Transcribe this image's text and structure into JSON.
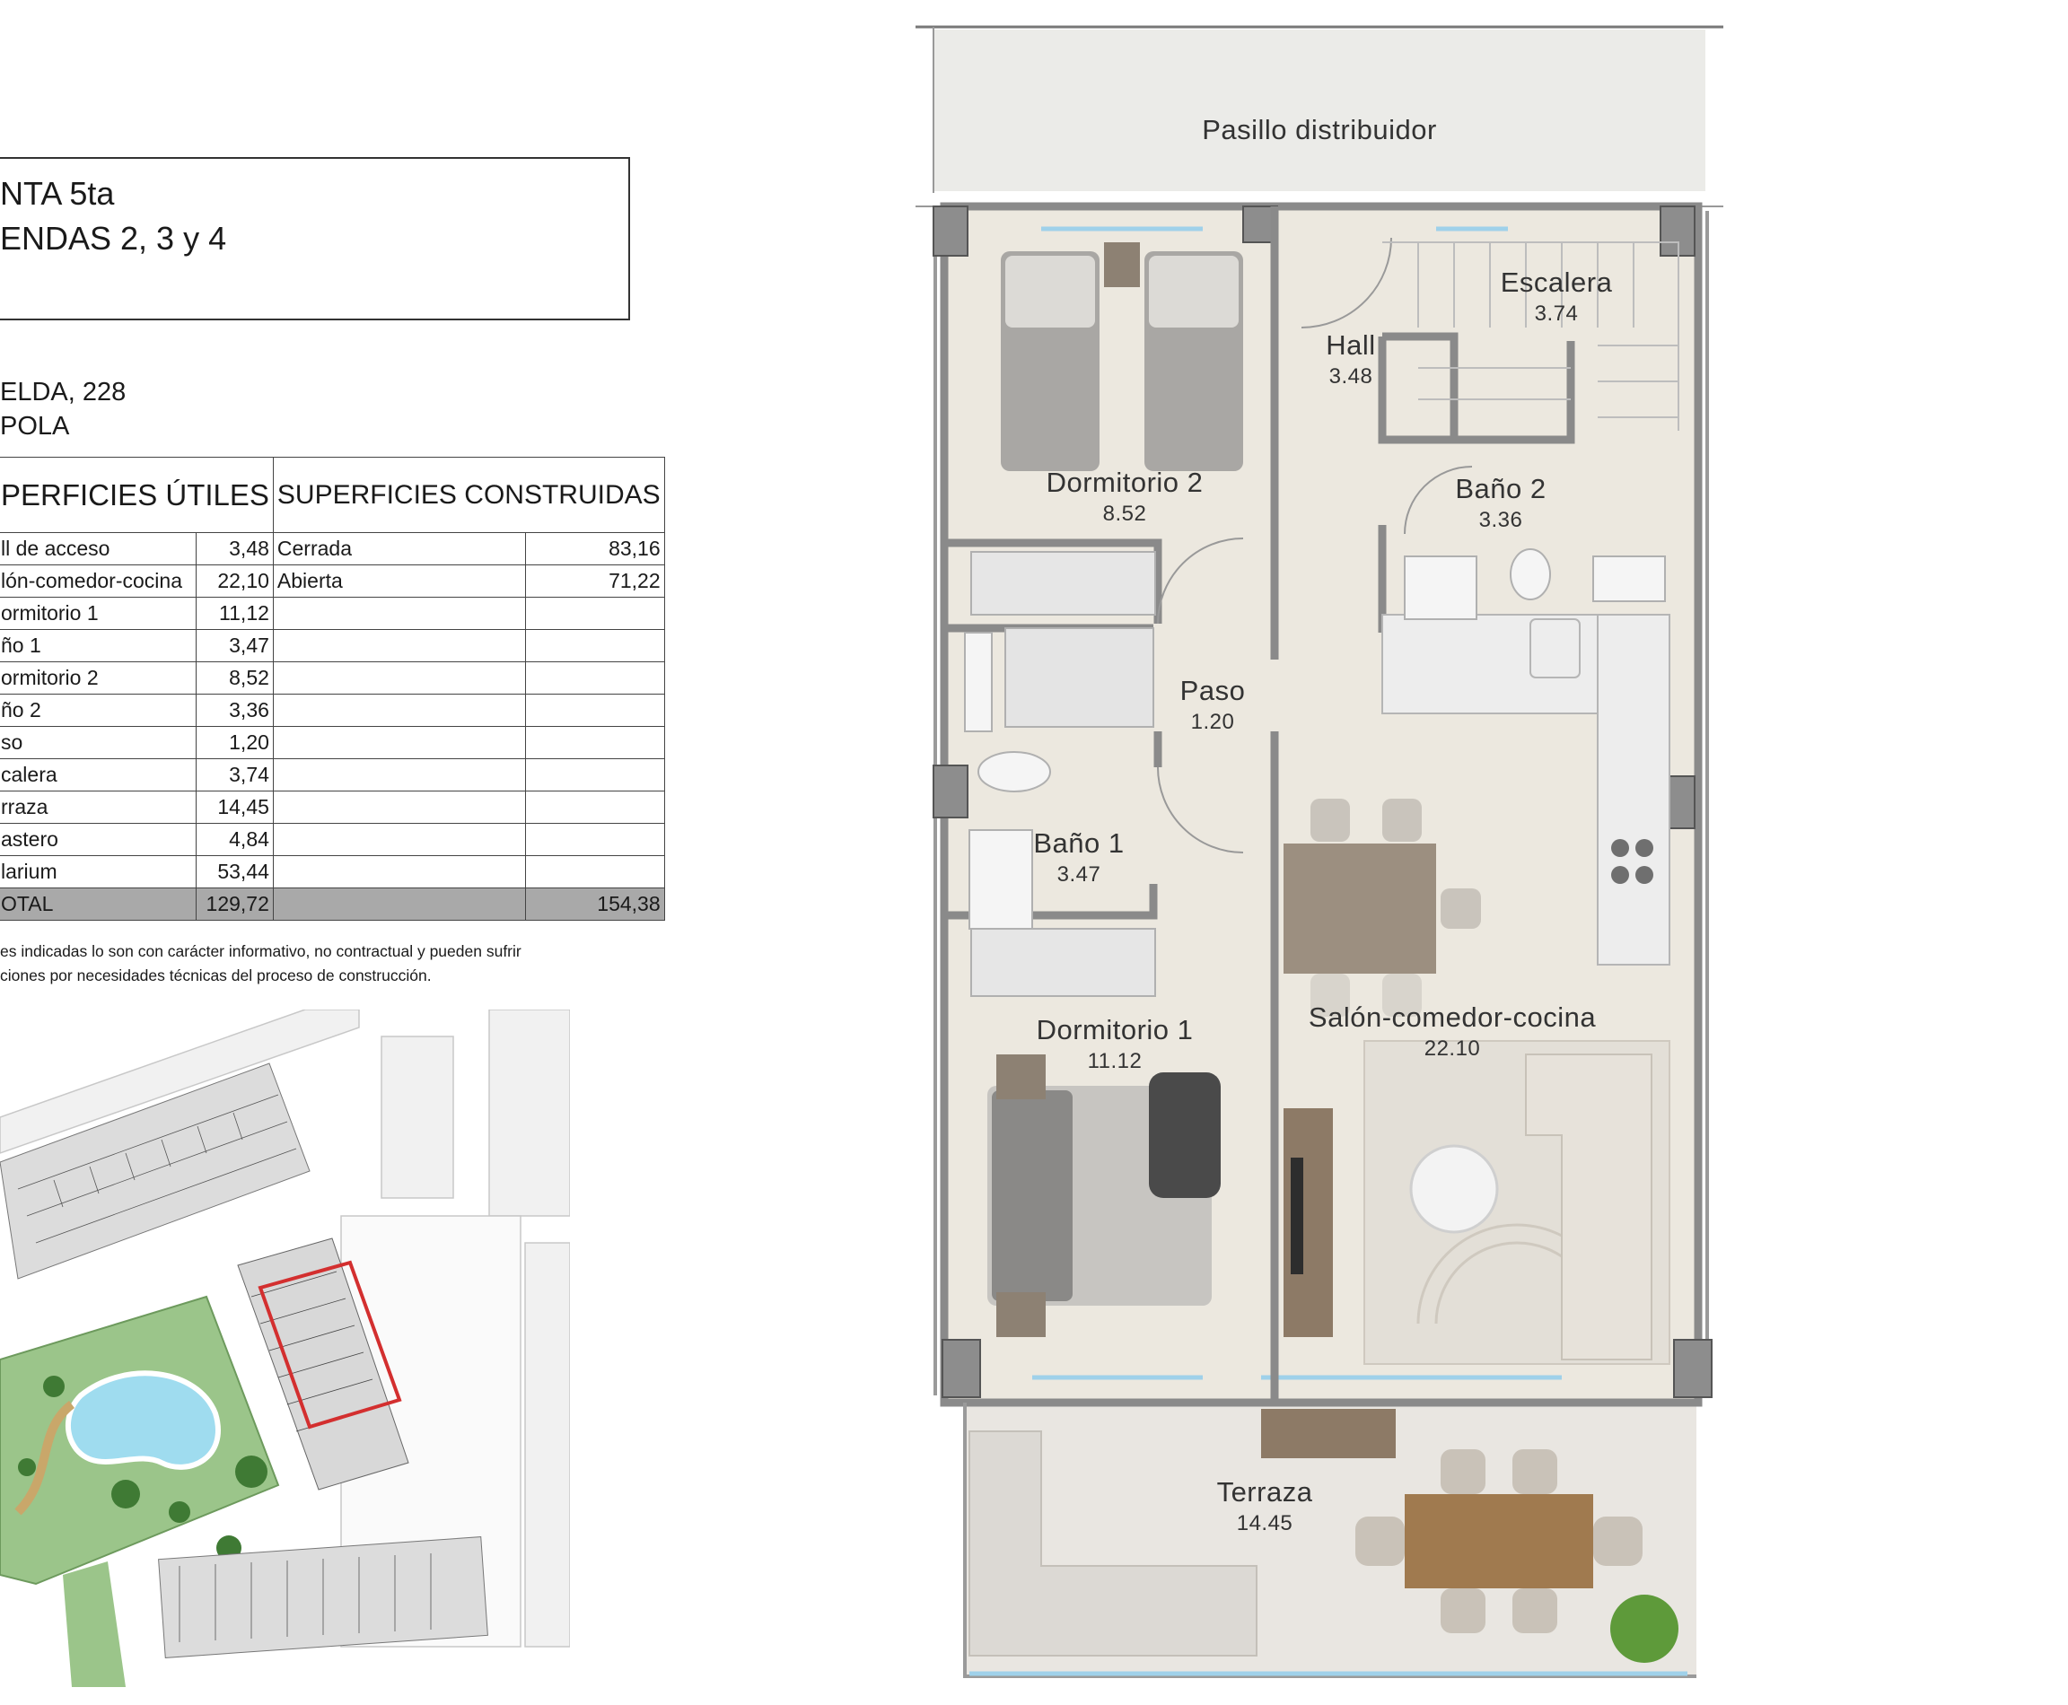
{
  "header": {
    "floor": "NTA 5ta",
    "units": "ENDAS 2, 3 y 4"
  },
  "address": {
    "street": "ELDA, 228",
    "town": "POLA"
  },
  "table": {
    "header_util": "PERFICIES ÚTILES",
    "header_construidas": "SUPERFICIES CONSTRUIDAS",
    "rows": [
      {
        "name": "ll de acceso",
        "value": "3,48",
        "c_name": "Cerrada",
        "c_value": "83,16"
      },
      {
        "name": "lón-comedor-cocina",
        "value": "22,10",
        "c_name": "Abierta",
        "c_value": "71,22"
      },
      {
        "name": "ormitorio 1",
        "value": "11,12",
        "c_name": "",
        "c_value": ""
      },
      {
        "name": "ño 1",
        "value": "3,47",
        "c_name": "",
        "c_value": ""
      },
      {
        "name": "ormitorio 2",
        "value": "8,52",
        "c_name": "",
        "c_value": ""
      },
      {
        "name": "ño 2",
        "value": "3,36",
        "c_name": "",
        "c_value": ""
      },
      {
        "name": "so",
        "value": "1,20",
        "c_name": "",
        "c_value": ""
      },
      {
        "name": "calera",
        "value": "3,74",
        "c_name": "",
        "c_value": ""
      },
      {
        "name": "rraza",
        "value": "14,45",
        "c_name": "",
        "c_value": ""
      },
      {
        "name": "astero",
        "value": "4,84",
        "c_name": "",
        "c_value": ""
      },
      {
        "name": "larium",
        "value": "53,44",
        "c_name": "",
        "c_value": ""
      }
    ],
    "total": {
      "name": "OTAL",
      "value": "129,72",
      "c_value": "154,38"
    }
  },
  "disclaimer": {
    "line1": "es indicadas lo son con carácter informativo, no contractual y pueden sufrir",
    "line2": "ciones por necesidades técnicas del proceso de construcción."
  },
  "plan": {
    "rooms": {
      "pasillo": {
        "name": "Pasillo distribuidor"
      },
      "escalera": {
        "name": "Escalera",
        "area": "3.74"
      },
      "hall": {
        "name": "Hall",
        "area": "3.48"
      },
      "dormitorio2": {
        "name": "Dormitorio 2",
        "area": "8.52"
      },
      "bano2": {
        "name": "Baño 2",
        "area": "3.36"
      },
      "paso": {
        "name": "Paso",
        "area": "1.20"
      },
      "bano1": {
        "name": "Baño 1",
        "area": "3.47"
      },
      "dormitorio1": {
        "name": "Dormitorio 1",
        "area": "11.12"
      },
      "salon": {
        "name": "Salón-comedor-cocina",
        "area": "22.10"
      },
      "terraza": {
        "name": "Terraza",
        "area": "14.45"
      }
    }
  },
  "colors": {
    "floor": "#ece8df",
    "wall": "#8a8a8a",
    "site_highlight": "#d32f2f",
    "pool": "#9fdcef",
    "garden": "#9bc58a"
  }
}
